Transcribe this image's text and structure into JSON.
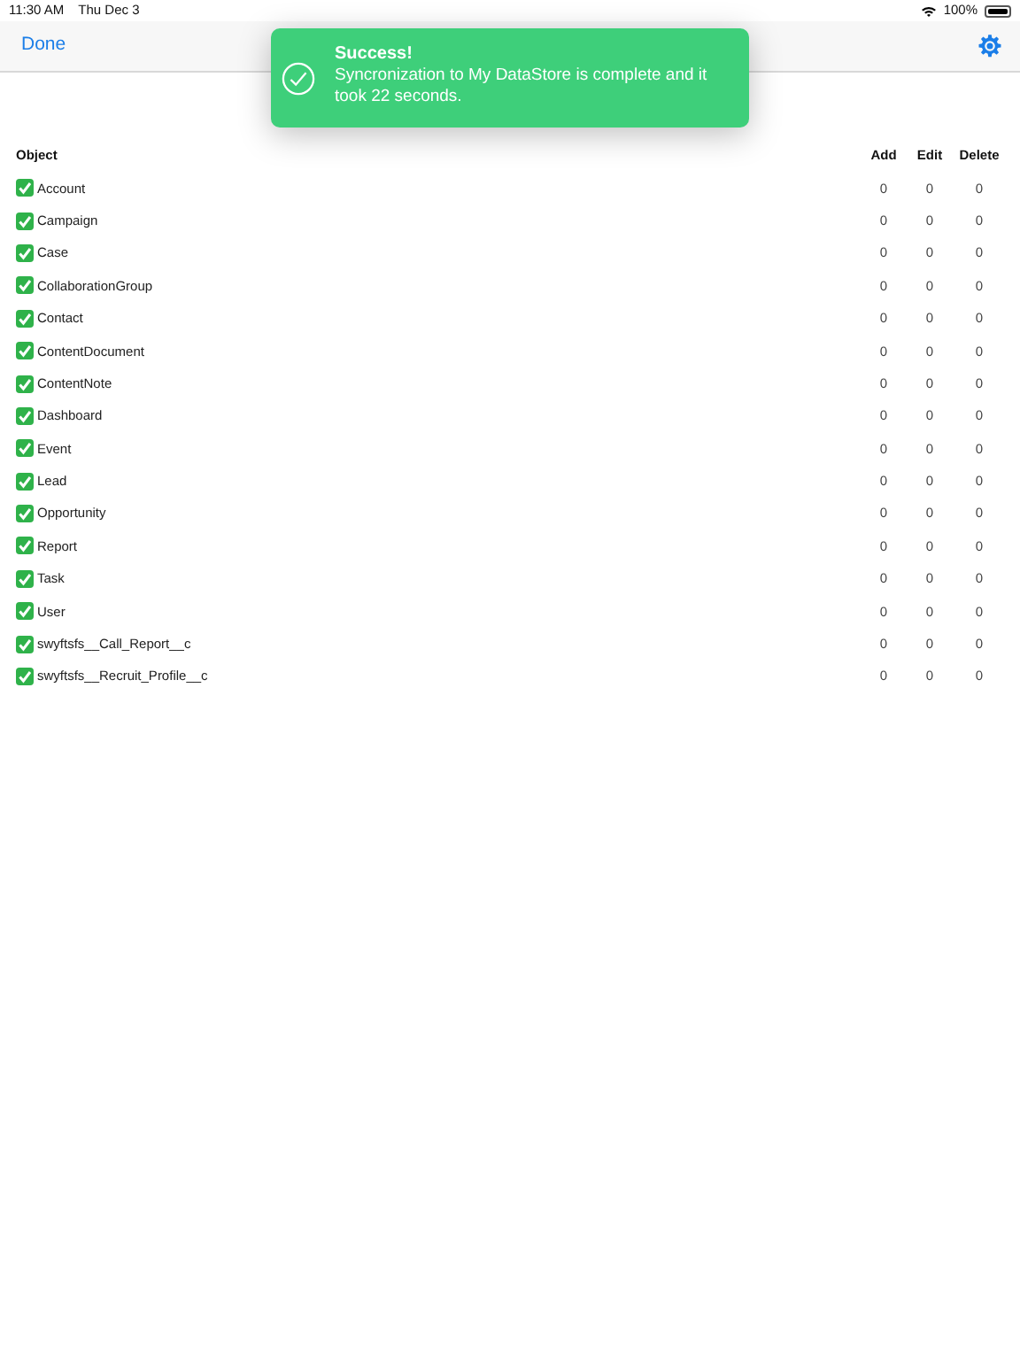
{
  "status_bar": {
    "time": "11:30 AM",
    "date": "Thu Dec 3",
    "battery": "100%"
  },
  "nav": {
    "left_button": "Done"
  },
  "toast": {
    "title": "Success!",
    "message": "Syncronization to My DataStore is complete and it took 22 seconds."
  },
  "table": {
    "columns": [
      "Object",
      "Add",
      "Edit",
      "Delete"
    ],
    "rows": [
      {
        "checked": true,
        "object": "Account",
        "add": "0",
        "edit": "0",
        "delete": "0"
      },
      {
        "checked": true,
        "object": "Campaign",
        "add": "0",
        "edit": "0",
        "delete": "0"
      },
      {
        "checked": true,
        "object": "Case",
        "add": "0",
        "edit": "0",
        "delete": "0"
      },
      {
        "checked": true,
        "object": "CollaborationGroup",
        "add": "0",
        "edit": "0",
        "delete": "0"
      },
      {
        "checked": true,
        "object": "Contact",
        "add": "0",
        "edit": "0",
        "delete": "0"
      },
      {
        "checked": true,
        "object": "ContentDocument",
        "add": "0",
        "edit": "0",
        "delete": "0"
      },
      {
        "checked": true,
        "object": "ContentNote",
        "add": "0",
        "edit": "0",
        "delete": "0"
      },
      {
        "checked": true,
        "object": "Dashboard",
        "add": "0",
        "edit": "0",
        "delete": "0"
      },
      {
        "checked": true,
        "object": "Event",
        "add": "0",
        "edit": "0",
        "delete": "0"
      },
      {
        "checked": true,
        "object": "Lead",
        "add": "0",
        "edit": "0",
        "delete": "0"
      },
      {
        "checked": true,
        "object": "Opportunity",
        "add": "0",
        "edit": "0",
        "delete": "0"
      },
      {
        "checked": true,
        "object": "Report",
        "add": "0",
        "edit": "0",
        "delete": "0"
      },
      {
        "checked": true,
        "object": "Task",
        "add": "0",
        "edit": "0",
        "delete": "0"
      },
      {
        "checked": true,
        "object": "User",
        "add": "0",
        "edit": "0",
        "delete": "0"
      },
      {
        "checked": true,
        "object": "swyftsfs__Call_Report__c",
        "add": "0",
        "edit": "0",
        "delete": "0"
      },
      {
        "checked": true,
        "object": "swyftsfs__Recruit_Profile__c",
        "add": "0",
        "edit": "0",
        "delete": "0"
      }
    ]
  }
}
